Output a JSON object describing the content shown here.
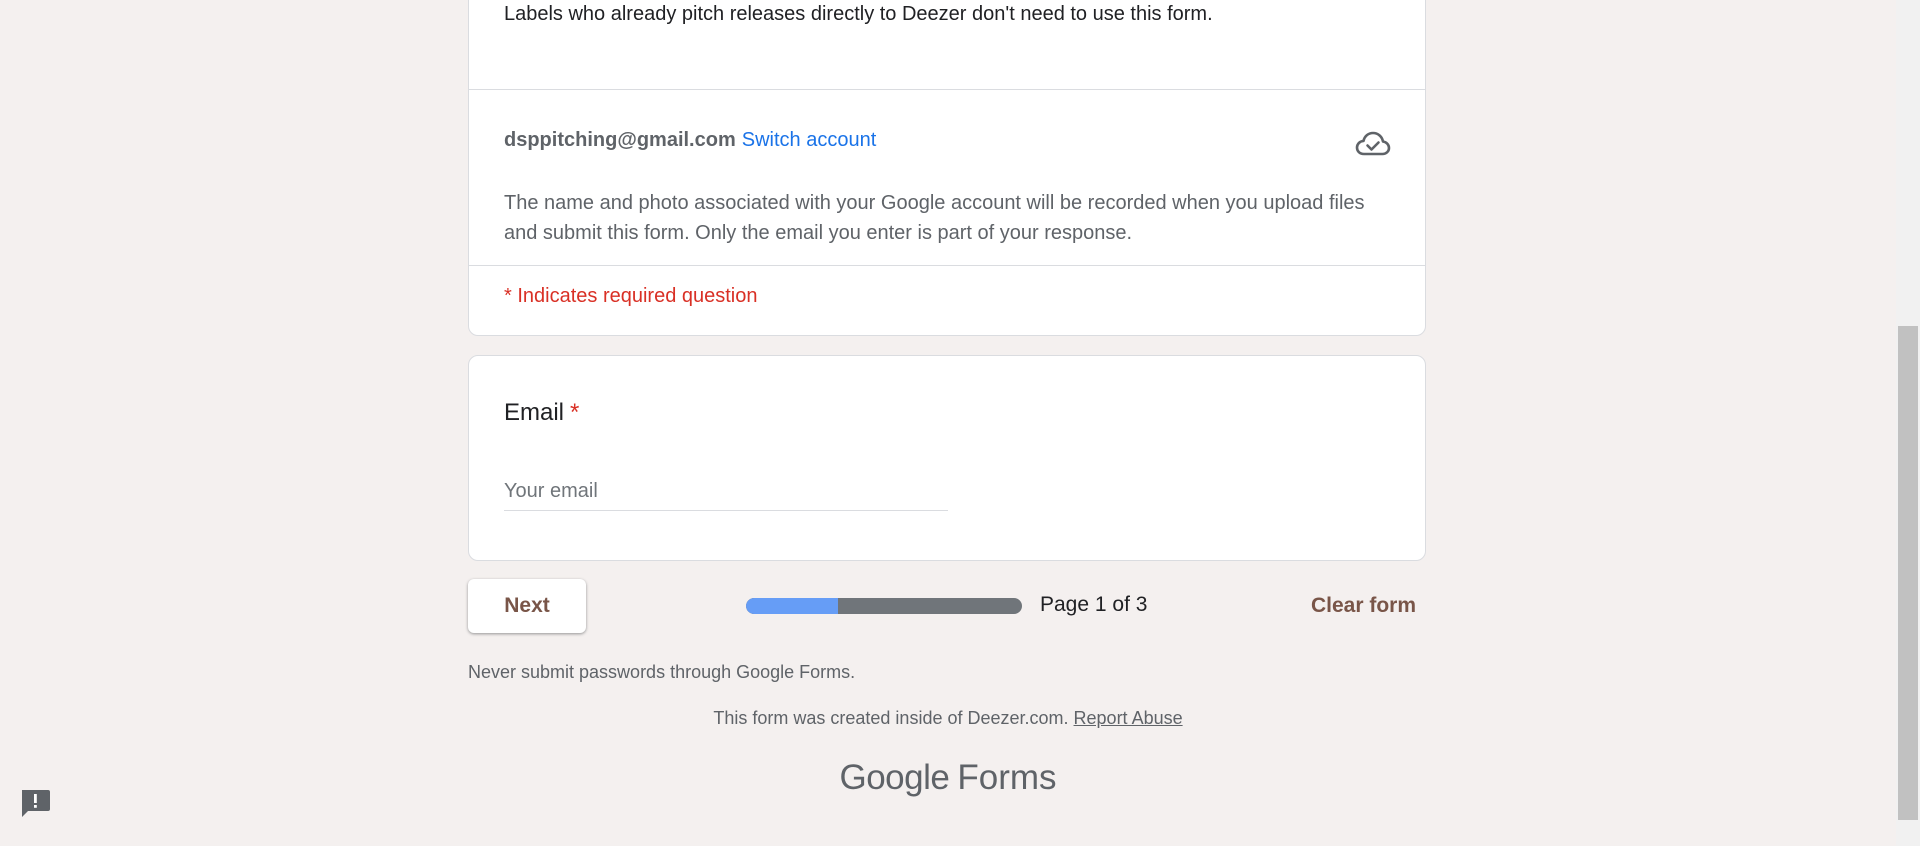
{
  "intro": {
    "description_tail": "Labels who already pitch releases directly to Deezer don't need to use this form.",
    "account_email": "dsppitching@gmail.com",
    "switch_account_label": "Switch account",
    "cloud_icon": "cloud-done-icon",
    "privacy_notice": "The name and photo associated with your Google account will be recorded when you upload files and submit this form. Only the email you enter is part of your response.",
    "required_note": "* Indicates required question"
  },
  "question": {
    "title": "Email",
    "required_marker": "*",
    "placeholder": "Your email",
    "value": ""
  },
  "navigation": {
    "next_label": "Next",
    "page_indicator": "Page 1 of 3",
    "progress_fraction": 0.333,
    "clear_label": "Clear form"
  },
  "footer": {
    "password_warning": "Never submit passwords through Google Forms.",
    "created_note": "This form was created inside of Deezer.com.",
    "report_abuse_label": "Report Abuse",
    "brand_google": "Google",
    "brand_forms": "Forms",
    "feedback_icon": "feedback-icon"
  },
  "colors": {
    "page_background": "#f4f0ef",
    "accent_text": "#795548",
    "link_blue": "#1a73e8",
    "required_red": "#d93025",
    "progress_fill": "#669df6",
    "progress_track": "#70757a"
  }
}
